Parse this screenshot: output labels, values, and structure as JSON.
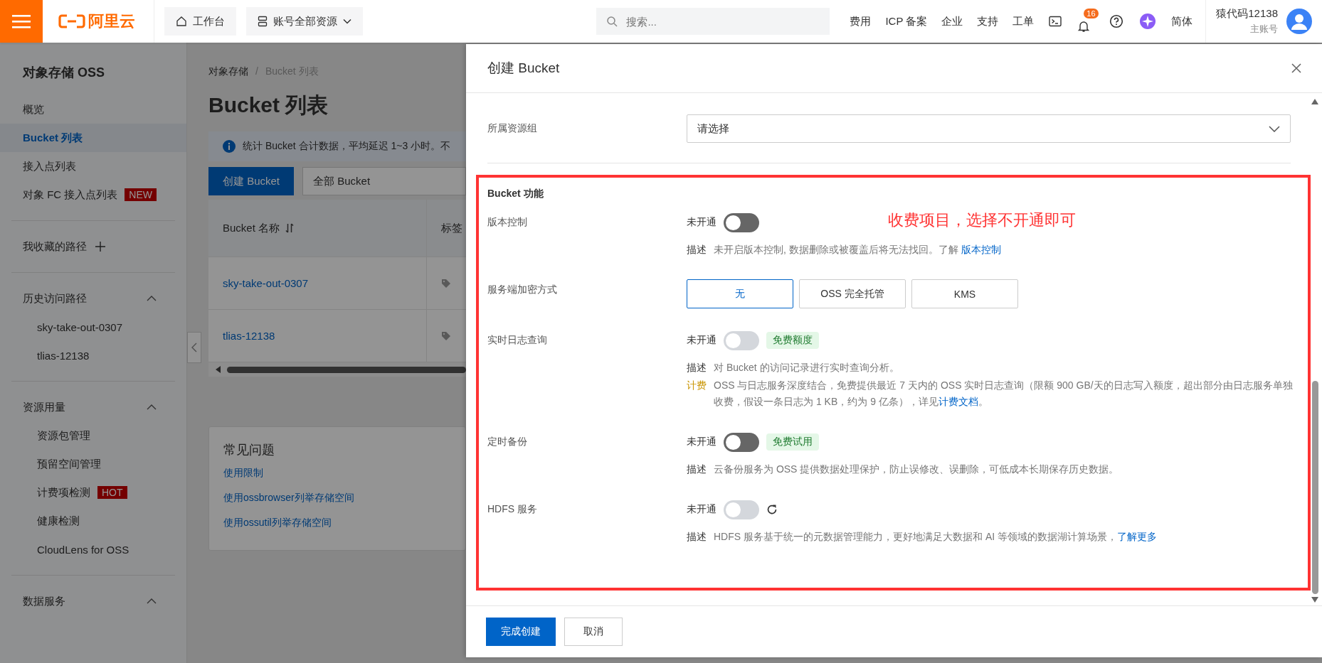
{
  "topbar": {
    "logo_text": "阿里云",
    "workbench": "工作台",
    "resources": "账号全部资源",
    "search": {
      "placeholder": "搜索..."
    },
    "nav": [
      "费用",
      "ICP 备案",
      "企业",
      "支持",
      "工单"
    ],
    "notification_count": "16",
    "language": "简体",
    "user": {
      "name": "猿代码12138",
      "role": "主账号"
    }
  },
  "sidebar": {
    "title": "对象存储 OSS",
    "items": [
      {
        "label": "概览",
        "selected": false
      },
      {
        "label": "Bucket 列表",
        "selected": true
      },
      {
        "label": "接入点列表",
        "selected": false
      },
      {
        "label": "对象 FC 接入点列表",
        "selected": false,
        "badge": "NEW"
      }
    ],
    "favorites": "我收藏的路径",
    "groups": [
      {
        "title": "历史访问路径",
        "expanded": true,
        "items": [
          {
            "label": "sky-take-out-0307"
          },
          {
            "label": "tlias-12138"
          }
        ]
      },
      {
        "title": "资源用量",
        "expanded": true,
        "items": [
          {
            "label": "资源包管理"
          },
          {
            "label": "预留空间管理"
          },
          {
            "label": "计费项检测",
            "badge": "HOT"
          },
          {
            "label": "健康检测"
          },
          {
            "label": "CloudLens for OSS"
          }
        ]
      },
      {
        "title": "数据服务",
        "expanded": true
      }
    ]
  },
  "main": {
    "breadcrumb": [
      "对象存储",
      "Bucket 列表"
    ],
    "breadcrumb_separator": "/",
    "title": "Bucket 列表",
    "notice": "统计 Bucket 合计数据，平均延迟 1~3 小时。不",
    "create_button": "创建 Bucket",
    "filter": "全部 Bucket",
    "table": {
      "columns": [
        "Bucket 名称",
        "标签"
      ],
      "rows": [
        {
          "name": "sky-take-out-0307"
        },
        {
          "name": "tlias-12138"
        }
      ]
    },
    "faq": {
      "title": "常见问题",
      "links": [
        "使用限制",
        "使用ossbrowser列举存储空间",
        "使用ossutil列举存储空间"
      ]
    }
  },
  "drawer": {
    "title": "创建 Bucket",
    "resource_group": {
      "label": "所属资源组",
      "placeholder": "请选择"
    },
    "section_title": "Bucket 功能",
    "annotation": "收费项目，选择不开通即可",
    "features": [
      {
        "kind": "toggle",
        "label": "版本控制",
        "status": "未开通",
        "on": false,
        "disabled": false,
        "descriptions": [
          {
            "label": "描述",
            "text": "未开启版本控制, 数据删除或被覆盖后将无法找回。了解 ",
            "link": "版本控制"
          }
        ]
      },
      {
        "kind": "segmented",
        "label": "服务端加密方式",
        "options": [
          {
            "label": "无",
            "selected": true
          },
          {
            "label": "OSS 完全托管",
            "selected": false
          },
          {
            "label": "KMS",
            "selected": false
          }
        ]
      },
      {
        "kind": "toggle",
        "label": "实时日志查询",
        "status": "未开通",
        "on": false,
        "disabled": true,
        "badge": "免费额度",
        "descriptions": [
          {
            "label": "描述",
            "text": "对 Bucket 的访问记录进行实时查询分析。"
          },
          {
            "label": "计费",
            "billing": true,
            "text": "OSS 与日志服务深度结合，免费提供最近 7 天内的 OSS 实时日志查询（限额 900 GB/天的日志写入额度，超出部分由日志服务单独收费，假设一条日志为 1 KB，约为 9 亿条），详见",
            "link": "计费文档",
            "suffix": "。"
          }
        ]
      },
      {
        "kind": "toggle",
        "label": "定时备份",
        "status": "未开通",
        "on": false,
        "disabled": false,
        "badge": "免费试用",
        "descriptions": [
          {
            "label": "描述",
            "text": "云备份服务为 OSS 提供数据处理保护，防止误修改、误删除，可低成本长期保存历史数据。"
          }
        ]
      },
      {
        "kind": "toggle",
        "label": "HDFS 服务",
        "status": "未开通",
        "on": false,
        "disabled": true,
        "refresh": true,
        "descriptions": [
          {
            "label": "描述",
            "text": "HDFS 服务基于统一的元数据管理能力，更好地满足大数据和 AI 等领域的数据湖计算场景，",
            "link": "了解更多"
          }
        ]
      }
    ],
    "buttons": [
      {
        "label": "完成创建",
        "kind": "primary"
      },
      {
        "label": "取消",
        "kind": "default"
      }
    ]
  }
}
